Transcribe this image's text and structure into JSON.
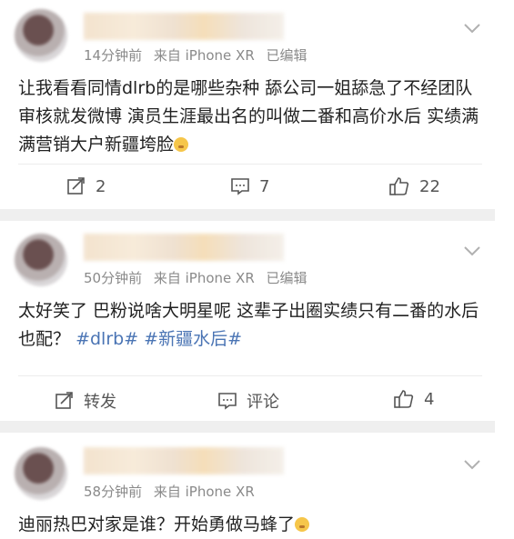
{
  "posts": [
    {
      "time": "14分钟前",
      "source": "来自 iPhone XR",
      "edited": "已编辑",
      "text": "让我看看同情dlrb的是哪些杂种 舔公司一姐舔急了不经团队审核就发微博 演员生涯最出名的叫做二番和高价水后 实绩满满营销大户新疆垮脸",
      "emoji": "thinking-face-icon",
      "repost": "2",
      "comment": "7",
      "like": "22"
    },
    {
      "time": "50分钟前",
      "source": "来自 iPhone XR",
      "edited": "已编辑",
      "text": "太好笑了 巴粉说啥大明星呢 这辈子出圈实绩只有二番的水后也配？",
      "tag1": "#dlrb#",
      "tag2": "#新疆水后#",
      "repost": "转发",
      "comment": "评论",
      "like": "4"
    },
    {
      "time": "58分钟前",
      "source": "来自 iPhone XR",
      "text": "迪丽热巴对家是谁？开始勇做马蜂了",
      "emoji": "face-icon"
    }
  ],
  "colors": {
    "tag": "#4a74b4",
    "meta": "#8a8a8a",
    "gap": "#efefef"
  }
}
